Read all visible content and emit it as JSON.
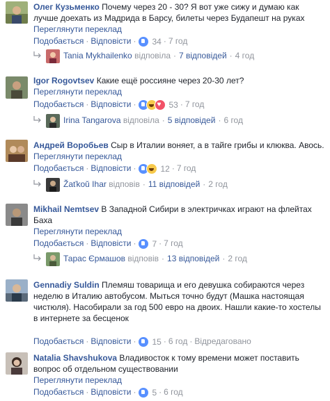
{
  "comments": [
    {
      "author": "Олег Кузьменко",
      "text": "Почему через 20 - 30? Я вот уже сижу и думаю как лучше доехать из Мадрида в Барсу, билеты через Будапешт на руках",
      "translate": "Переглянути переклад",
      "like": "Подобається",
      "reply": "Відповісти",
      "reaction_count": "34",
      "time": "7 год",
      "reactions": [
        "like"
      ],
      "replies": {
        "author": "Tania Mykhailenko",
        "verb": "відповіла",
        "count_text": "7 відповідей",
        "time": "4 год"
      }
    },
    {
      "author": "Igor Rogovtsev",
      "text": "Какие ещё россияне через 20-30 лет?",
      "translate": "Переглянути переклад",
      "like": "Подобається",
      "reply": "Відповісти",
      "reaction_count": "53",
      "time": "7 год",
      "reactions": [
        "like",
        "haha",
        "love"
      ],
      "replies": {
        "author": "Irina Tangarova",
        "verb": "відповіла",
        "count_text": "5 відповідей",
        "time": "6 год"
      }
    },
    {
      "author": "Андрей Воробьев",
      "text": "Сыр в Италии воняет, а в тайге грибы и клюква. Авось.",
      "translate": "Переглянути переклад",
      "like": "Подобається",
      "reply": "Відповісти",
      "reaction_count": "12",
      "time": "7 год",
      "reactions": [
        "like",
        "haha"
      ],
      "replies": {
        "author": "Žaťkoŭ Ihar",
        "verb": "відповів",
        "count_text": "11 відповідей",
        "time": "2 год"
      }
    },
    {
      "author": "Mikhail Nemtsev",
      "text": "В Западной Сибири в электричках играют на флейтах Баха",
      "translate": "Переглянути переклад",
      "like": "Подобається",
      "reply": "Відповісти",
      "reaction_count": "7",
      "time": "7 год",
      "reactions": [
        "like"
      ],
      "replies": {
        "author": "Тарас Єрмашов",
        "verb": "відповів",
        "count_text": "13 відповідей",
        "time": "2 год"
      }
    },
    {
      "author": "Gennadiy Suldin",
      "text": "Племяш товарища и его девушка собираются через неделю в Италию автобусом. Мыться точно будут (Машка настоящая чистюля). Насобирали за год 500 евро на двоих. Нашли какие-то хостелы в интернете за бесценок",
      "translate": "",
      "like": "Подобається",
      "reply": "Відповісти",
      "reaction_count": "15",
      "time": "6 год",
      "edited": "Відредаговано",
      "reactions": [
        "like"
      ]
    },
    {
      "author": "Natalia Shavshukova",
      "text": "Владивосток к тому времени может поставить вопрос об отдельном существовании",
      "translate": "Переглянути переклад",
      "like": "Подобається",
      "reply": "Відповісти",
      "reaction_count": "5",
      "time": "6 год",
      "reactions": [
        "like"
      ]
    }
  ],
  "colors": {
    "link": "#365899",
    "meta": "#90949c",
    "text": "#1d2129",
    "like_blue": "#5890ff",
    "haha_yellow": "#f7c94b",
    "love_red": "#f25268"
  },
  "reply_arrow_icon": "reply-arrow-icon"
}
